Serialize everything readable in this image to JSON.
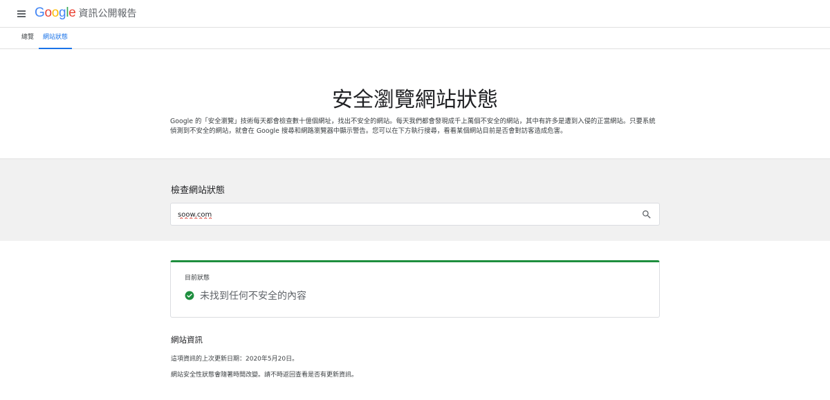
{
  "app": {
    "logo_letters": [
      "G",
      "o",
      "o",
      "g",
      "l",
      "e"
    ],
    "product_name": "資訊公開報告"
  },
  "tabs": [
    {
      "label": "總覽",
      "active": false
    },
    {
      "label": "網站狀態",
      "active": true
    }
  ],
  "hero": {
    "title": "安全瀏覽網站狀態",
    "description": "Google 的「安全瀏覽」技術每天都會檢查數十億個網址，找出不安全的網站。每天我們都會發現成千上萬個不安全的網站，其中有許多是遭到入侵的正當網站。只要系統偵測到不安全的網站，就會在 Google 搜尋和網路瀏覽器中顯示警告。您可以在下方執行搜尋，看看某個網站目前是否會對訪客造成危害。"
  },
  "search": {
    "label": "檢查網站狀態",
    "value": "soow.com"
  },
  "status": {
    "label": "目前狀態",
    "text": "未找到任何不安全的內容",
    "color": "#1e8e3e"
  },
  "site_info": {
    "title": "網站資訊",
    "updated": "這項資訊的上次更新日期：2020年5月20日。",
    "note": "網站安全性狀態會隨著時間改變。請不時返回查看是否有更新資訊。"
  },
  "colors": {
    "accent": "#1a73e8",
    "safe": "#1e8e3e"
  },
  "icons": {
    "menu": "menu-icon",
    "search": "search-icon",
    "status": "check-circle-icon"
  }
}
